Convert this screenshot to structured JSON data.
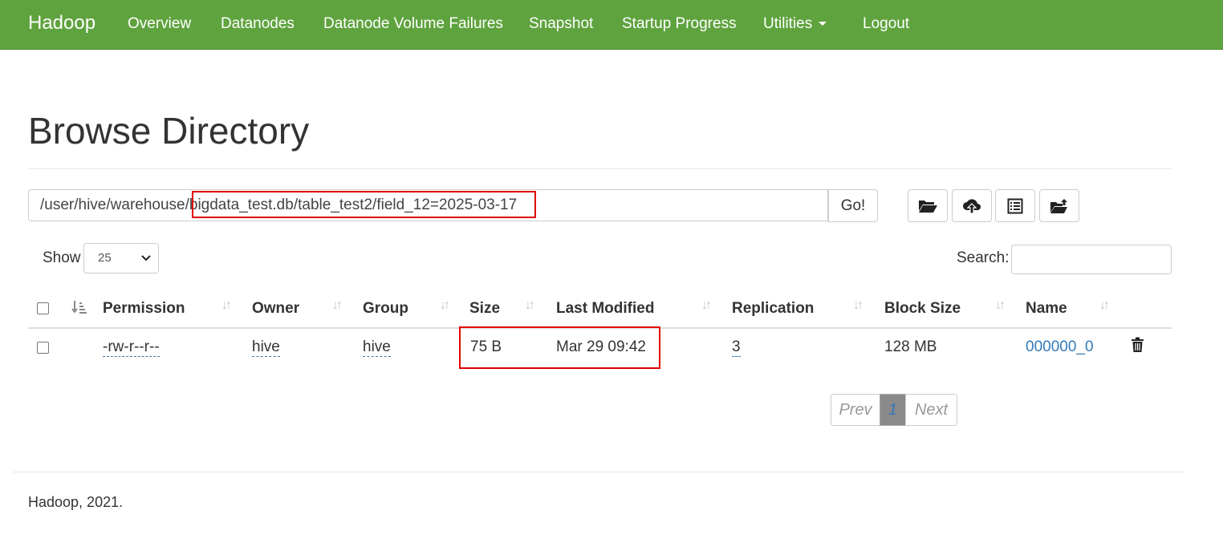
{
  "navbar": {
    "brand": "Hadoop",
    "items": [
      "Overview",
      "Datanodes",
      "Datanode Volume Failures",
      "Snapshot",
      "Startup Progress",
      "Utilities",
      "Logout"
    ]
  },
  "page": {
    "title": "Browse Directory"
  },
  "path_bar": {
    "value": "/user/hive/warehouse/bigdata_test.db/table_test2/field_12=2025-03-17",
    "go_label": "Go!"
  },
  "toolbar": {
    "icons": [
      "folder-open-icon",
      "cloud-upload-icon",
      "list-icon",
      "folder-upload-icon"
    ]
  },
  "table_controls": {
    "show_label": "Show",
    "show_value": "25",
    "search_label": "Search:"
  },
  "table": {
    "headers": [
      "Permission",
      "Owner",
      "Group",
      "Size",
      "Last Modified",
      "Replication",
      "Block Size",
      "Name"
    ],
    "rows": [
      {
        "permission": "-rw-r--r--",
        "owner": "hive",
        "group": "hive",
        "size": "75 B",
        "last_modified": "Mar 29 09:42",
        "replication": "3",
        "block_size": "128 MB",
        "name": "000000_0"
      }
    ]
  },
  "pagination": {
    "prev": "Prev",
    "current": "1",
    "next": "Next"
  },
  "footer": {
    "text": "Hadoop, 2021."
  },
  "colors": {
    "navbar": "#5fa33e",
    "link": "#337ab7",
    "highlight": "#e00000"
  }
}
